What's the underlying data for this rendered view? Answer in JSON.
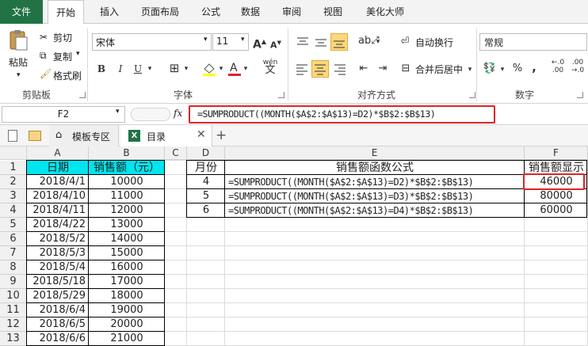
{
  "menu": [
    "文件",
    "开始",
    "插入",
    "页面布局",
    "公式",
    "数据",
    "审阅",
    "视图",
    "美化大师"
  ],
  "ribbon": {
    "paste": "粘贴",
    "cut": "剪切",
    "copy": "复制",
    "format_painter": "格式刷",
    "clipboard_label": "剪贴板",
    "font_name": "宋体",
    "font_size": "11",
    "bold": "B",
    "italic": "I",
    "underline": "U",
    "font_label": "字体",
    "wrap_text": "自动换行",
    "merge_center": "合并后居中",
    "align_label": "对齐方式",
    "number_format": "常规",
    "percent": "%",
    "comma": ",",
    "number_label": "数字"
  },
  "formula_bar": {
    "name_box": "F2",
    "fx": "fx",
    "formula": "=SUMPRODUCT((MONTH($A$2:$A$13)=D2)*$B$2:$B$13)"
  },
  "tabs": {
    "template": "模板专区",
    "sheet": "目录"
  },
  "columns": [
    "A",
    "B",
    "C",
    "D",
    "E",
    "F"
  ],
  "rows": [
    "1",
    "2",
    "3",
    "4",
    "5",
    "6",
    "7",
    "8",
    "9",
    "10",
    "11",
    "12",
    "13"
  ],
  "headers": {
    "a1": "日期",
    "b1": "销售额（元）",
    "d1": "月份",
    "e1": "销售额函数公式",
    "f1": "销售额显示"
  },
  "dates": [
    "2018/4/1",
    "2018/4/10",
    "2018/4/11",
    "2018/4/22",
    "2018/5/2",
    "2018/5/3",
    "2018/5/4",
    "2018/5/18",
    "2018/5/29",
    "2018/6/4",
    "2018/6/5",
    "2018/6/6"
  ],
  "sales": [
    "10000",
    "11000",
    "12000",
    "13000",
    "14000",
    "15000",
    "16000",
    "17000",
    "18000",
    "19000",
    "20000",
    "21000"
  ],
  "months": [
    "4",
    "5",
    "6"
  ],
  "formulas": [
    "=SUMPRODUCT((MONTH($A$2:$A$13)=D2)*$B$2:$B$13)",
    "=SUMPRODUCT((MONTH($A$2:$A$13)=D3)*$B$2:$B$13)",
    "=SUMPRODUCT((MONTH($A$2:$A$13)=D4)*$B$2:$B$13)"
  ],
  "results": [
    "46000",
    "80000",
    "60000"
  ],
  "colors": {
    "header_fill": "#00e5ee",
    "highlight": "#e02424",
    "file_tab": "#217346",
    "active_button": "#fdd77a"
  }
}
